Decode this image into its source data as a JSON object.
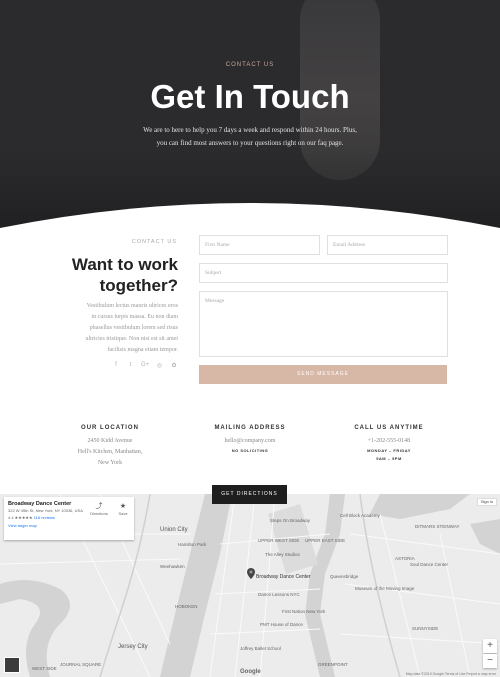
{
  "hero": {
    "eyebrow": "CONTACT US",
    "title": "Get In Touch",
    "subtitle_line1": "We are to here to help you 7 days a week and respond within 24 hours. Plus,",
    "subtitle_line2": "you can find most answers to your questions right on our faq page."
  },
  "contact": {
    "eyebrow": "CONTACT US",
    "title_line1": "Want to work",
    "title_line2": "together?",
    "body_lines": [
      "Vestibulum lectus mauris ultrices eros",
      "in cursus turpis massa. Eu non diam",
      "phasellus vestibulum lorem sed risus",
      "ultricies tristique. Non nisi est sit amet",
      "facilisis magna etiam tempor."
    ],
    "socials": [
      "f",
      "t",
      "G+",
      "◎",
      "✿"
    ]
  },
  "form": {
    "first_name": "First Name",
    "email": "Email Address",
    "subject": "Subject",
    "message": "Message",
    "send": "SEND MESSAGE"
  },
  "info": {
    "location": {
      "title": "OUR LOCATION",
      "lines": [
        "2450 Kidd Avenue",
        "Hell's Kitchen, Manhattan,",
        "New York"
      ]
    },
    "mailing": {
      "title": "MAILING ADDRESS",
      "email": "hello@company.com",
      "note": "NO SOLICITING"
    },
    "call": {
      "title": "CALL US ANYTIME",
      "phone": "+1-202-555-0148",
      "days": "MONDAY – FRIDAY",
      "hours": "9AM – 5PM"
    }
  },
  "directions_button": "GET DIRECTIONS",
  "map": {
    "place_name": "Broadway Dance Center",
    "address": "322 W 45th St, New York, NY 10036, USA",
    "rating": "4.4 ★★★★★",
    "reviews": "116 reviews",
    "larger_map": "View larger map",
    "directions_label": "Directions",
    "save_label": "Save",
    "signin": "Sign in",
    "pin_label": "Broadway Dance Center",
    "labels": {
      "union_city": "Union City",
      "weehawken": "Weehawken",
      "hoboken": "HOBOKEN",
      "jersey_city": "Jersey City",
      "steps_on_broadway": "Steps On Broadway",
      "upper_west_side": "UPPER WEST SIDE",
      "upper_east_side": "UPPER EAST SIDE",
      "cell_block": "Cell Block Academy",
      "alley_studios": "The Alley Studios",
      "dance_lessons": "Dance Lessons NYC",
      "pmt": "PMT House of Dance",
      "first_nation": "First Nation New York",
      "joffrey": "Joffrey Ballet School",
      "greenpoint": "GREENPOINT",
      "sunnyside": "SUNNYSIDE",
      "astoria": "ASTORIA",
      "queensbridge": "Queensbridge",
      "moving_image": "Museum of the Moving Image",
      "soul_dance": "Soul Dance Center",
      "hamilton_park": "Hamilton Park",
      "journal_square": "JOURNAL SQUARE",
      "west_side": "WEST SIDE",
      "ditmars": "DITMARS STEINWAY"
    },
    "footer": "Map data ©2019 Google   Terms of Use   Report a map error",
    "google": "Google"
  }
}
